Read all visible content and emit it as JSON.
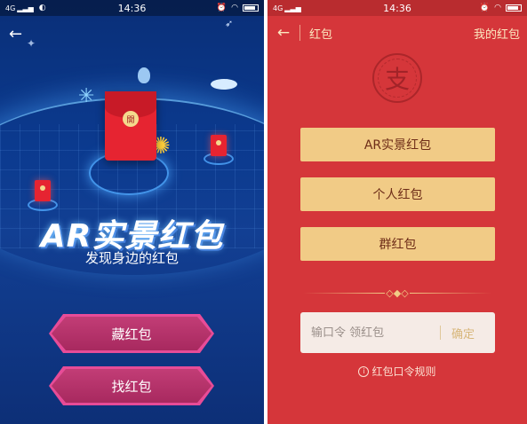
{
  "status_bar": {
    "network": "4G",
    "time": "14:36"
  },
  "left_screen": {
    "envelope_seal": "開",
    "title": "AR实景红包",
    "subtitle": "发现身边的红包",
    "buttons": {
      "hide": "藏红包",
      "find": "找红包"
    }
  },
  "right_screen": {
    "header": {
      "title": "红包",
      "my_red_packets": "我的红包"
    },
    "logo_char": "支",
    "menu": [
      {
        "label": "AR实景红包"
      },
      {
        "label": "个人红包"
      },
      {
        "label": "群红包"
      }
    ],
    "code_input": {
      "placeholder": "输口令 领红包",
      "value": "",
      "confirm": "确定"
    },
    "rules_link": "红包口令规则"
  },
  "colors": {
    "left_bg": "#0b3a8f",
    "right_bg": "#d5363a",
    "gold_button": "#f1cb86",
    "pink_button": "#c23d76",
    "envelope_red": "#e62431"
  },
  "icons": [
    "back-arrow-icon",
    "signal-icon",
    "wechat-icon",
    "alarm-icon",
    "wifi-icon",
    "battery-icon",
    "info-icon",
    "satellite-icon",
    "rocket-icon"
  ]
}
